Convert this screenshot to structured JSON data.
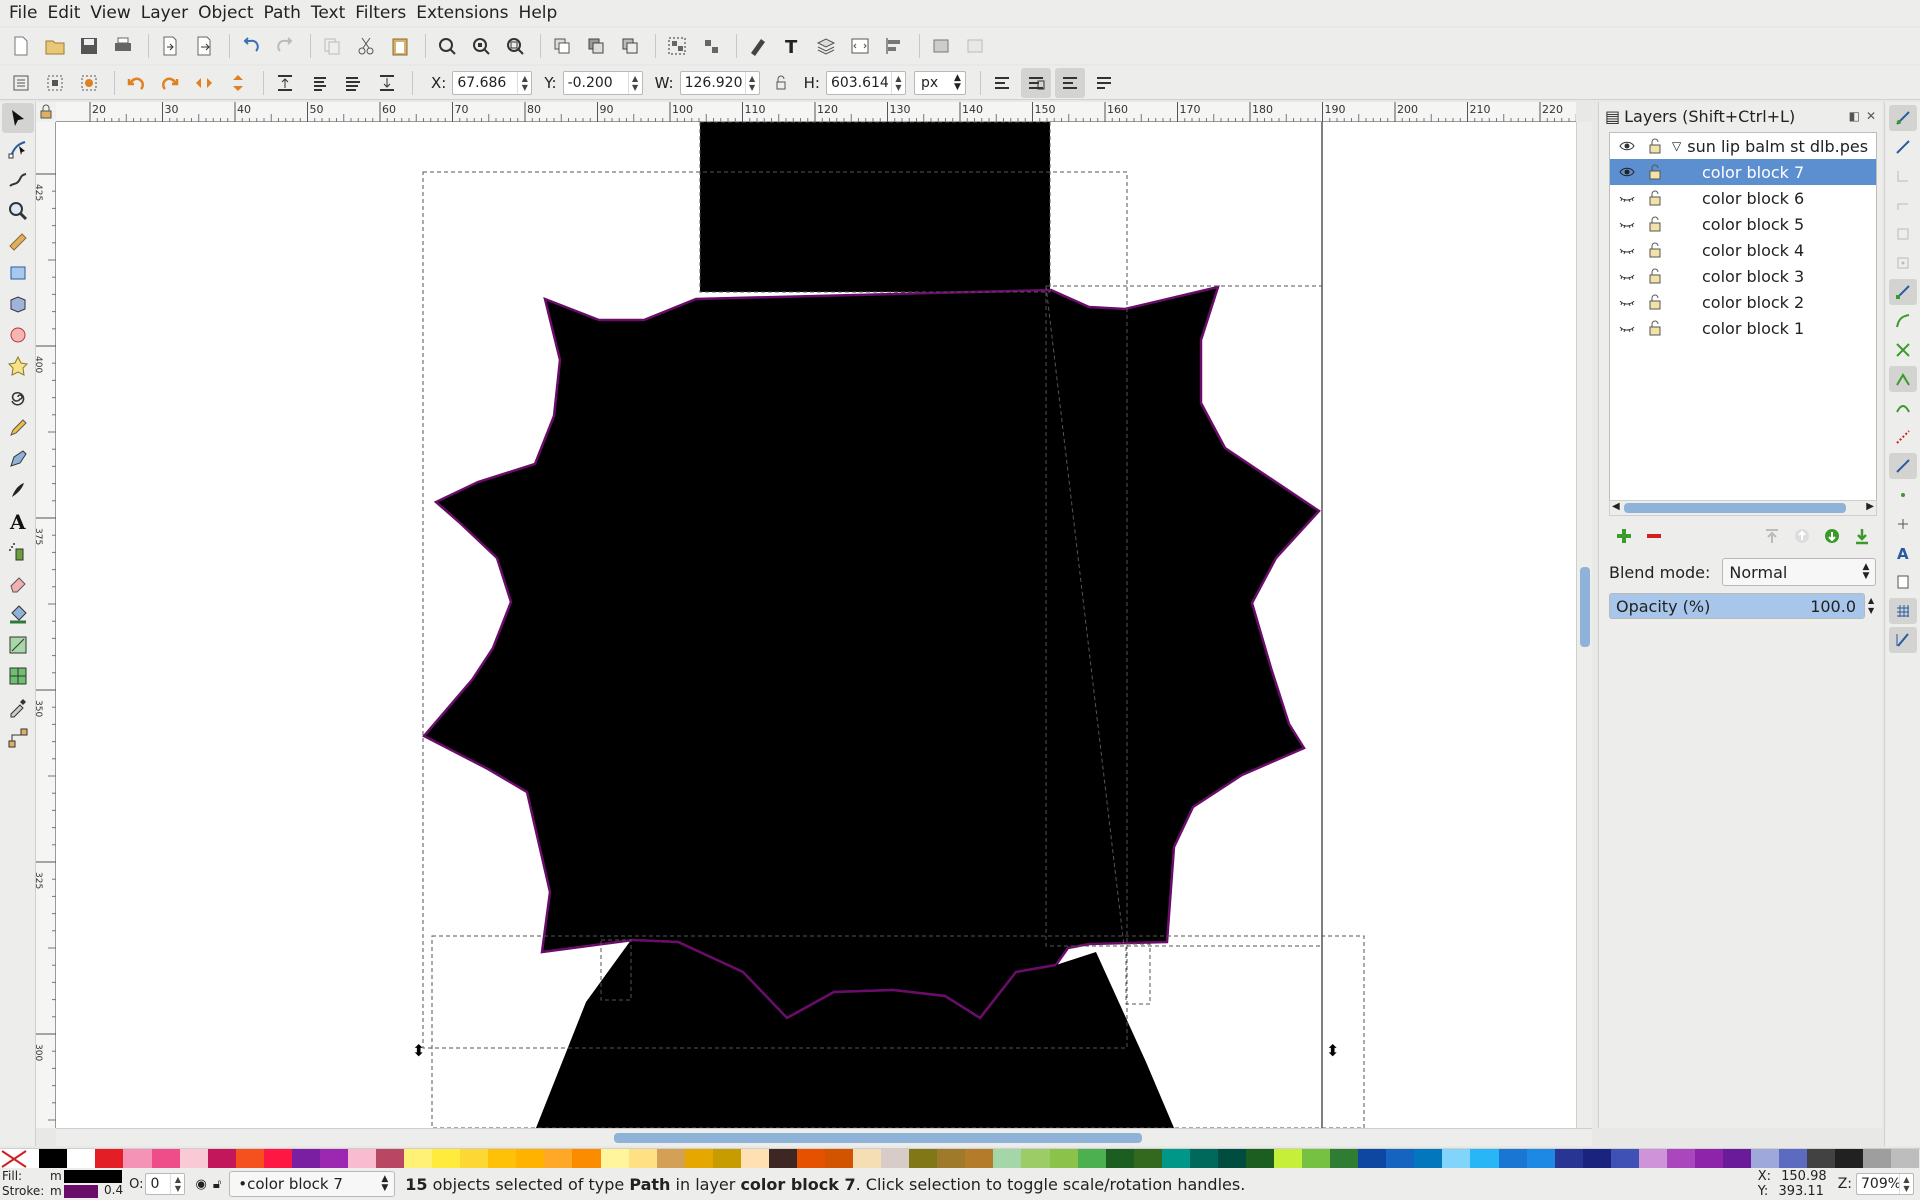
{
  "menu": [
    "File",
    "Edit",
    "View",
    "Layer",
    "Object",
    "Path",
    "Text",
    "Filters",
    "Extensions",
    "Help"
  ],
  "toolctrl": {
    "x_label": "X:",
    "x_value": "67.686",
    "y_label": "Y:",
    "y_value": "-0.200",
    "w_label": "W:",
    "w_value": "126.920",
    "h_label": "H:",
    "h_value": "603.614",
    "unit": "px"
  },
  "ruler": {
    "h_ticks": [
      "20",
      "30",
      "40",
      "50",
      "60",
      "70",
      "80",
      "90",
      "100",
      "110",
      "120",
      "130",
      "140",
      "150",
      "160",
      "170",
      "180",
      "190",
      "200",
      "210",
      "220"
    ],
    "v_ticks": [
      "425",
      "400",
      "375",
      "350",
      "325",
      "300"
    ]
  },
  "layers": {
    "title": "Layers (Shift+Ctrl+L)",
    "root": "sun lip balm st dlb.pes",
    "items": [
      "color block 7",
      "color block 6",
      "color block 5",
      "color block 4",
      "color block 3",
      "color block 2",
      "color block 1"
    ],
    "selected_index": 0,
    "blend_label": "Blend mode:",
    "blend_value": "Normal",
    "opacity_label": "Opacity (%)",
    "opacity_value": "100.0",
    "opacity_fraction": 1.0
  },
  "palette": [
    "#000000",
    "#ffffff",
    "#e31e24",
    "#f493b5",
    "#ef4c8a",
    "#f9c9d6",
    "#c2185b",
    "#f4511e",
    "#ff1744",
    "#7b1fa2",
    "#9c27b0",
    "#f8bbd0",
    "#b94763",
    "#fff176",
    "#ffeb3b",
    "#fdd835",
    "#ffc107",
    "#ffb300",
    "#ffa726",
    "#fb8c00",
    "#fff59d",
    "#ffe082",
    "#d4a056",
    "#e6a800",
    "#c69c00",
    "#ffe0b2",
    "#3e2723",
    "#e65100",
    "#d35400",
    "#f5deb3",
    "#d7ccc8",
    "#827717",
    "#9e7a2a",
    "#b47b2a",
    "#a5d6a7",
    "#9ccc65",
    "#8bc34a",
    "#4caf50",
    "#1b5e20",
    "#33691e",
    "#009688",
    "#00695c",
    "#004d40",
    "#1b5e20",
    "#c6ef3a",
    "#76c042",
    "#2e7d32",
    "#0d47a1",
    "#1565c0",
    "#0277bd",
    "#81d4fa",
    "#29b6f6",
    "#1976d2",
    "#1e88e5",
    "#283593",
    "#1a237e",
    "#3f51b5",
    "#ce93d8",
    "#ab47bc",
    "#8e24aa",
    "#6a1b9a",
    "#9fa8da",
    "#5c6bc0",
    "#424242",
    "#212121",
    "#9e9e9e",
    "#bdbdbd"
  ],
  "status": {
    "fill_label": "Fill:",
    "stroke_label": "Stroke:",
    "fill_value": "m",
    "stroke_value": "m",
    "stroke_width": "0.4",
    "opacity_label": "O:",
    "opacity_value": "0",
    "layer": "•color block 7",
    "msg_count": "15",
    "msg_a": " objects selected of type ",
    "msg_type": "Path",
    "msg_b": " in layer ",
    "msg_layer": "color block 7",
    "msg_c": ". Click selection to toggle scale/rotation handles.",
    "x_label": "X:",
    "x_value": "150.98",
    "y_label": "Y:",
    "y_value": "393.11",
    "zoom_label": "Z:",
    "zoom_value": "709%"
  },
  "colors": {
    "selected_row": "#5c8fd0",
    "stroke_purple": "#6a0d6a",
    "accent_orange": "#e08020"
  }
}
